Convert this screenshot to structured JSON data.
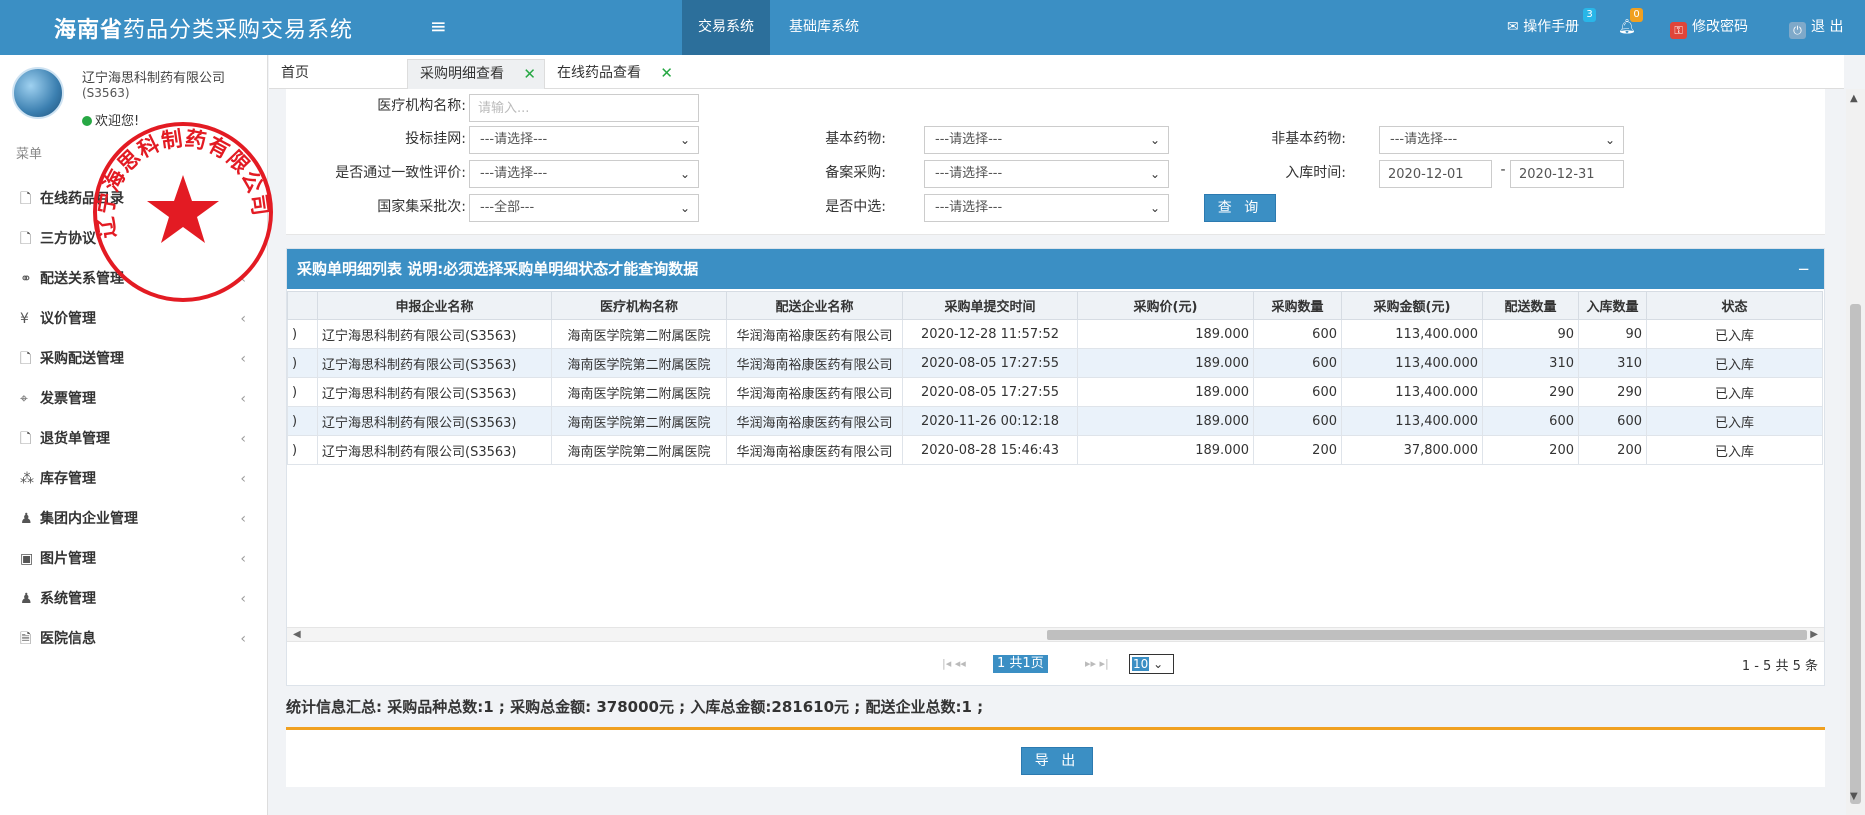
{
  "header": {
    "brand_bold": "海南省",
    "brand_rest": "药品分类采购交易系统",
    "menu_icon": "≡",
    "tabs": [
      {
        "label": "交易系统"
      },
      {
        "label": "基础库系统"
      }
    ],
    "manual": {
      "label": "操作手册",
      "badge": "3"
    },
    "notify_badge": "0",
    "change_password": "修改密码",
    "logout": "退 出",
    "accent_color": "#3b8fc4"
  },
  "user": {
    "name": "辽宁海思科制药有限公司",
    "code": "(S3563)",
    "welcome": "欢迎您!"
  },
  "stamp": {
    "text": "辽宁海思科制药有限公司",
    "color": "#e31b23"
  },
  "sidebar": {
    "title": "菜单",
    "items": [
      {
        "label": "在线药品目录",
        "icon": "file-icon"
      },
      {
        "label": "三方协议",
        "icon": "file-icon"
      },
      {
        "label": "配送关系管理",
        "icon": "link-icon"
      },
      {
        "label": "议价管理",
        "icon": "yen-icon"
      },
      {
        "label": "采购配送管理",
        "icon": "file-icon"
      },
      {
        "label": "发票管理",
        "icon": "tag-icon"
      },
      {
        "label": "退货单管理",
        "icon": "file-icon"
      },
      {
        "label": "库存管理",
        "icon": "cubes-icon"
      },
      {
        "label": "集团内企业管理",
        "icon": "user-icon"
      },
      {
        "label": "图片管理",
        "icon": "image-icon"
      },
      {
        "label": "系统管理",
        "icon": "user-icon"
      },
      {
        "label": "医院信息",
        "icon": "doc-icon"
      }
    ]
  },
  "page_tabs": [
    {
      "label": "首页"
    },
    {
      "label": "采购明细查看"
    },
    {
      "label": "在线药品查看"
    }
  ],
  "filters": {
    "hospital_label": "医疗机构名称:",
    "hospital_placeholder": "请输入...",
    "bid_label": "投标挂网:",
    "bid_value": "---请选择---",
    "basic_label": "基本药物:",
    "basic_value": "---请选择---",
    "nonbasic_label": "非基本药物:",
    "nonbasic_value": "---请选择---",
    "consistency_label": "是否通过一致性评价:",
    "consistency_value": "---请选择---",
    "record_label": "备案采购:",
    "record_value": "---请选择---",
    "instock_label": "入库时间:",
    "date_from": "2020-12-01",
    "date_sep": "-",
    "date_to": "2020-12-31",
    "batch_label": "国家集采批次:",
    "batch_value": "---全部---",
    "selected_label": "是否中选:",
    "selected_value": "---请选择---",
    "query_button": "查 询"
  },
  "list": {
    "title": "采购单明细列表 说明:必须选择采购单明细状态才能查询数据",
    "collapse": "−",
    "columns": [
      "",
      "申报企业名称",
      "医疗机构名称",
      "配送企业名称",
      "采购单提交时间",
      "采购价(元)",
      "采购数量",
      "采购金额(元)",
      "配送数量",
      "入库数量",
      "状态"
    ],
    "rows": [
      [
        ")",
        "辽宁海思科制药有限公司(S3563)",
        "海南医学院第二附属医院",
        "华润海南裕康医药有限公司",
        "2020-12-28 11:57:52",
        "189.000",
        "600",
        "113,400.000",
        "90",
        "90",
        "已入库"
      ],
      [
        ")",
        "辽宁海思科制药有限公司(S3563)",
        "海南医学院第二附属医院",
        "华润海南裕康医药有限公司",
        "2020-08-05 17:27:55",
        "189.000",
        "600",
        "113,400.000",
        "310",
        "310",
        "已入库"
      ],
      [
        ")",
        "辽宁海思科制药有限公司(S3563)",
        "海南医学院第二附属医院",
        "华润海南裕康医药有限公司",
        "2020-08-05 17:27:55",
        "189.000",
        "600",
        "113,400.000",
        "290",
        "290",
        "已入库"
      ],
      [
        ")",
        "辽宁海思科制药有限公司(S3563)",
        "海南医学院第二附属医院",
        "华润海南裕康医药有限公司",
        "2020-11-26 00:12:18",
        "189.000",
        "600",
        "113,400.000",
        "600",
        "600",
        "已入库"
      ],
      [
        ")",
        "辽宁海思科制药有限公司(S3563)",
        "海南医学院第二附属医院",
        "华润海南裕康医药有限公司",
        "2020-08-28 15:46:43",
        "189.000",
        "200",
        "37,800.000",
        "200",
        "200",
        "已入库"
      ]
    ],
    "pager": {
      "current": "1",
      "total_pages": "共1页",
      "page_size": "10",
      "info": "1 - 5  共 5 条"
    }
  },
  "summary": "统计信息汇总:  采购品种总数:1 ; 采购总金额: 378000元 ; 入库总金额:281610元 ; 配送企业总数:1 ;",
  "export_button": "导 出"
}
